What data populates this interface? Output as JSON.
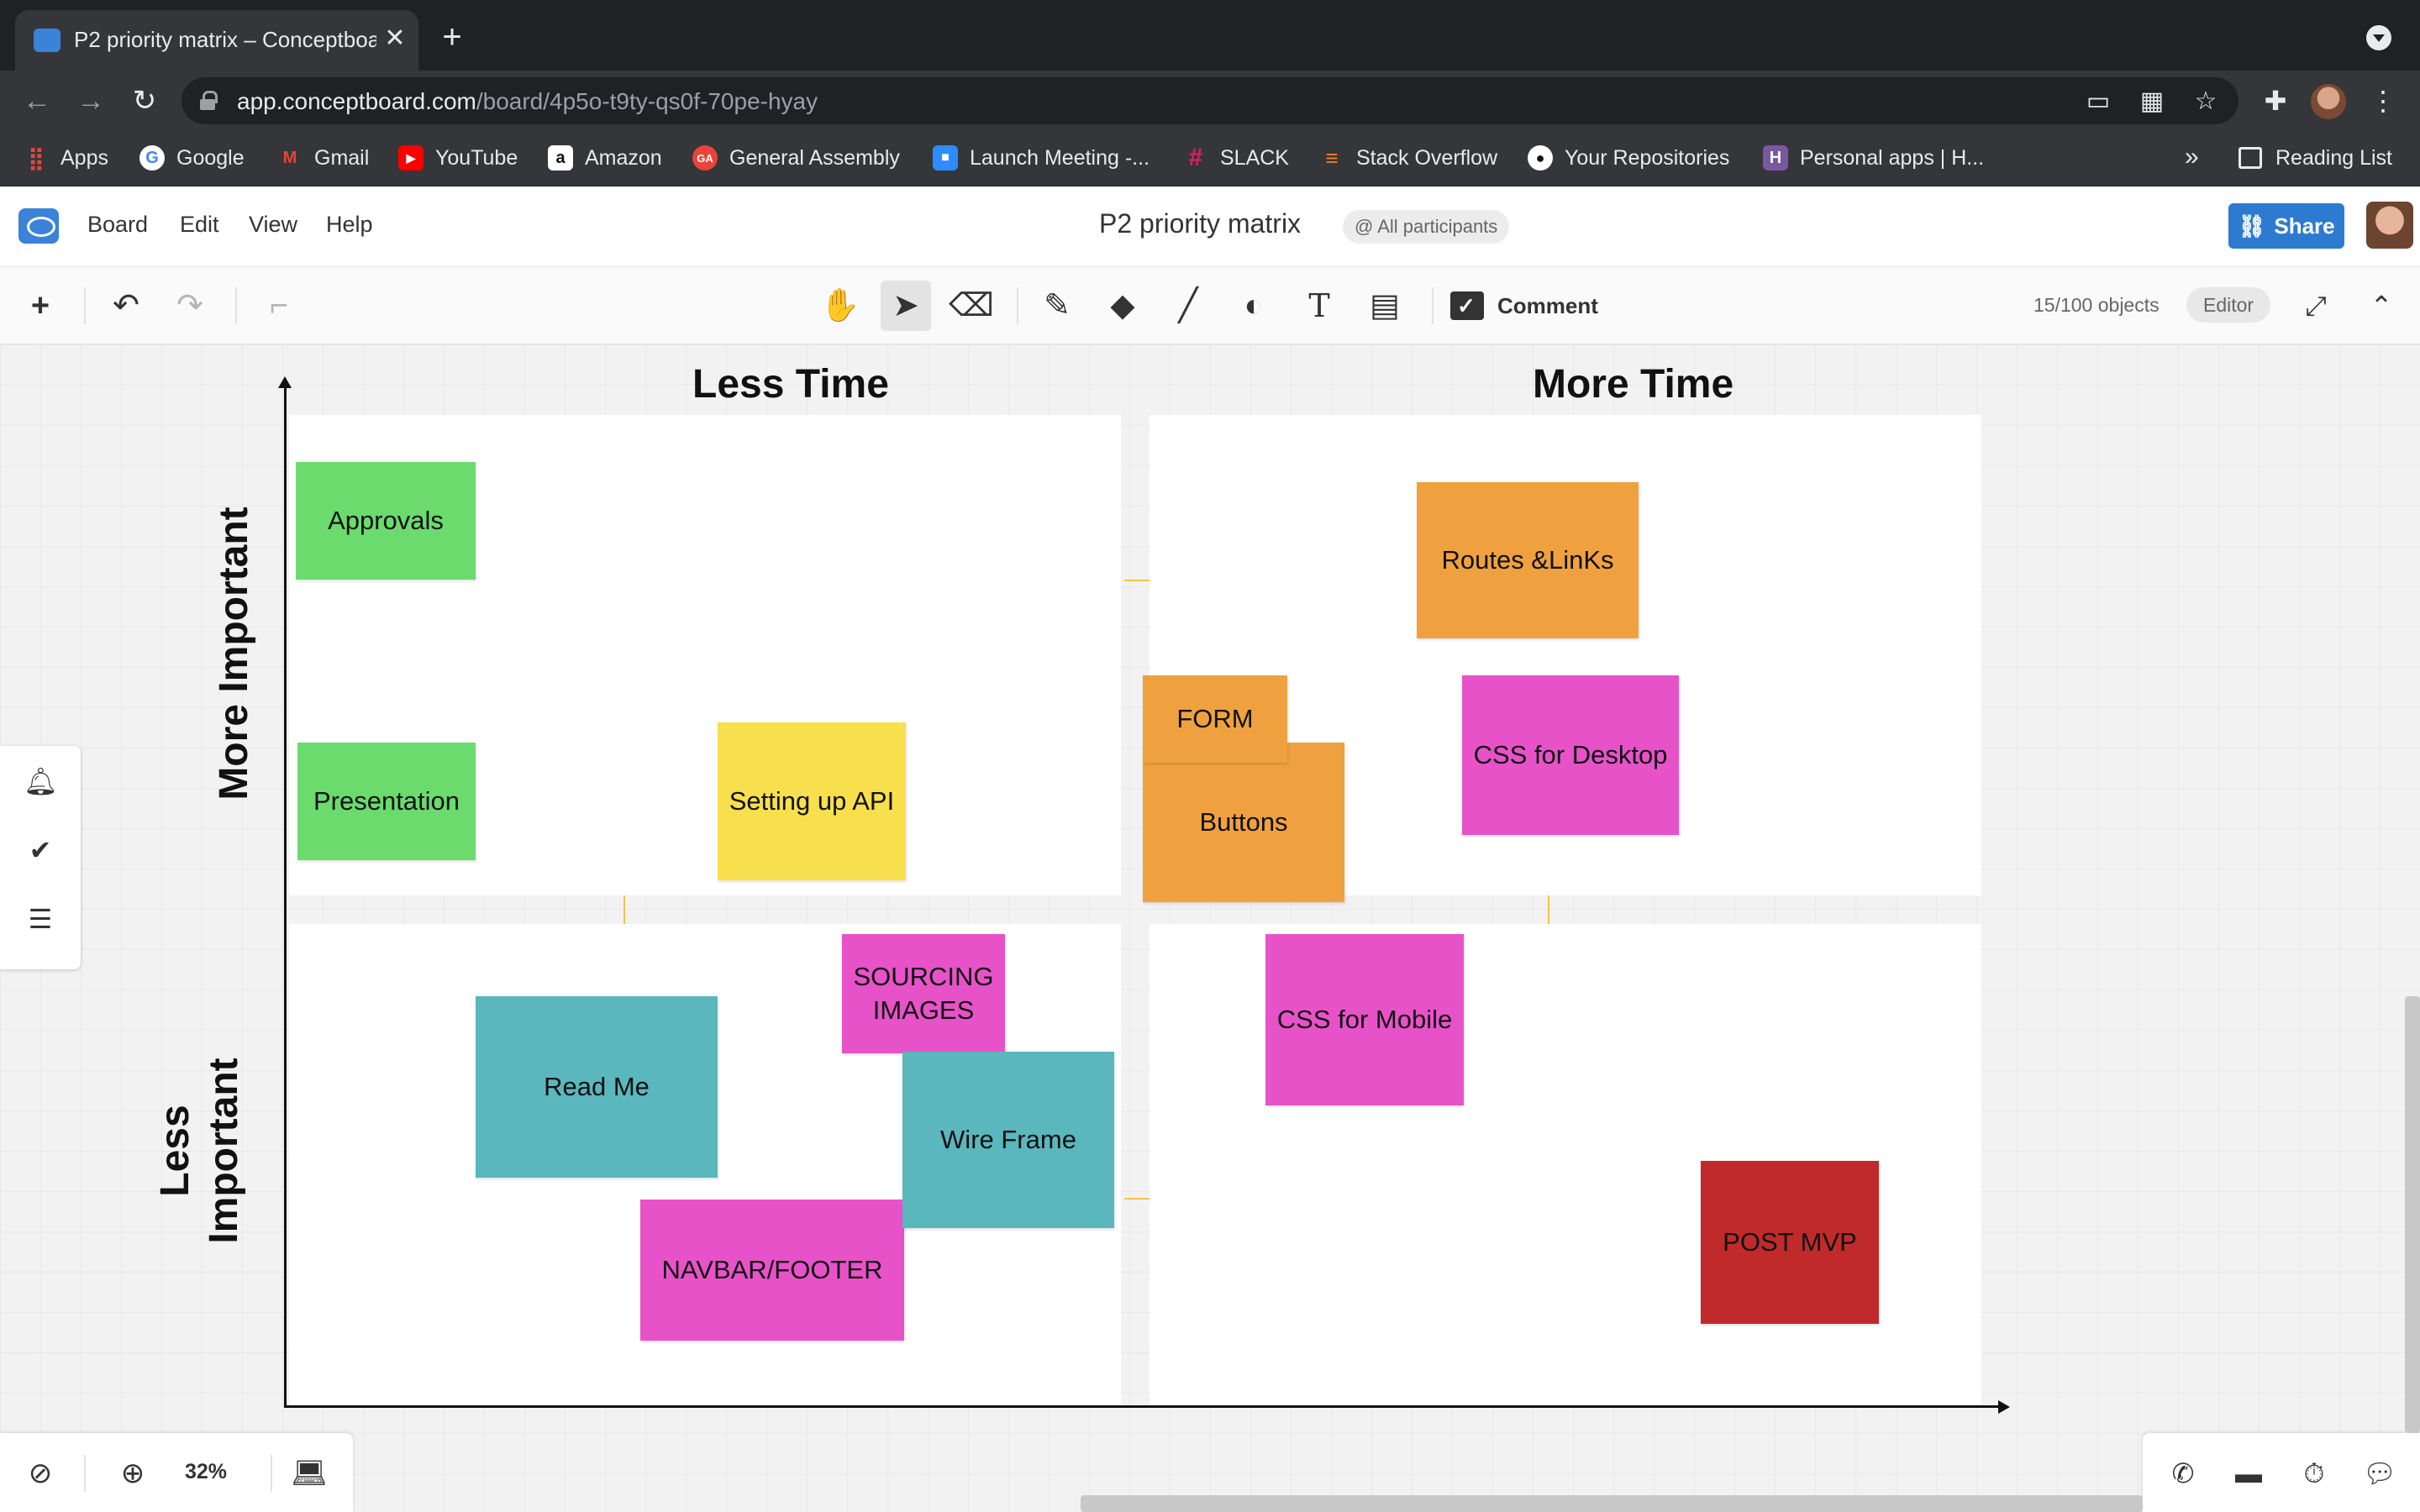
{
  "browser": {
    "tab_title": "P2 priority matrix – Conceptboard",
    "url_host": "app.conceptboard.com",
    "url_path": "/board/4p5o-t9ty-qs0f-70pe-hyay",
    "bookmarks": [
      {
        "label": "Apps",
        "icon": "apps-grid-icon",
        "color": "#e8453c"
      },
      {
        "label": "Google",
        "icon": "google-icon",
        "color": "#ffffff"
      },
      {
        "label": "Gmail",
        "icon": "gmail-icon",
        "color": "#ea4335"
      },
      {
        "label": "YouTube",
        "icon": "youtube-icon",
        "color": "#ff0000"
      },
      {
        "label": "Amazon",
        "icon": "amazon-icon",
        "color": "#ffffff"
      },
      {
        "label": "General Assembly",
        "icon": "general-assembly-icon",
        "color": "#e9443a"
      },
      {
        "label": "Launch Meeting -...",
        "icon": "zoom-icon",
        "color": "#2d8cff"
      },
      {
        "label": "SLACK",
        "icon": "slack-icon",
        "color": "#e01e5a"
      },
      {
        "label": "Stack Overflow",
        "icon": "stackoverflow-icon",
        "color": "#f48024"
      },
      {
        "label": "Your Repositories",
        "icon": "github-icon",
        "color": "#ffffff"
      },
      {
        "label": "Personal apps | H...",
        "icon": "heroku-icon",
        "color": "#79589f"
      }
    ],
    "more_bookmarks": "»",
    "reading_list": "Reading List"
  },
  "app": {
    "menu": [
      "Board",
      "Edit",
      "View",
      "Help"
    ],
    "board_title": "P2 priority matrix",
    "participants": "@ All participants",
    "share_label": "Share",
    "comment_label": "Comment",
    "object_count": "15/100 objects",
    "role": "Editor",
    "zoom": "32%",
    "brand_color": "#2d7bd1"
  },
  "matrix": {
    "col_less_time": "Less Time",
    "col_more_time": "More Time",
    "row_more_important": "More Important",
    "row_less_important_1": "Less",
    "row_less_important_2": "Important"
  },
  "stickies": {
    "approvals": "Approvals",
    "presentation": "Presentation",
    "setting_up_api": "Setting up API",
    "routes_links": "Routes &LinKs",
    "form": "FORM",
    "buttons": "Buttons",
    "css_desktop": "CSS for Desktop",
    "sourcing_images": "SOURCING IMAGES",
    "read_me": "Read Me",
    "wire_frame": "Wire Frame",
    "navbar_footer": "NAVBAR/FOOTER",
    "css_mobile": "CSS for Mobile",
    "post_mvp": "POST MVP"
  }
}
